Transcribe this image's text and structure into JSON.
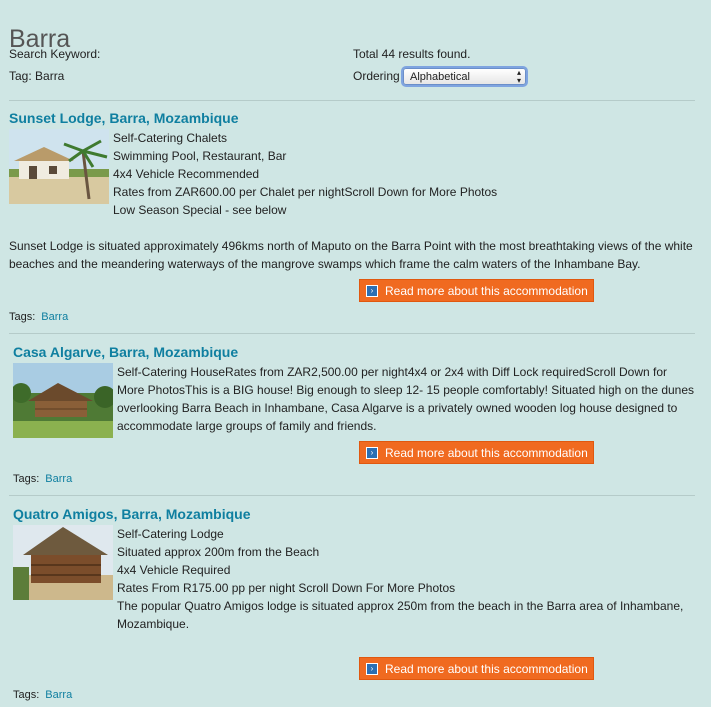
{
  "page": {
    "title": "Barra"
  },
  "search": {
    "keyword_label": "Search Keyword:",
    "tag_label": "Tag: Barra",
    "results_text": "Total 44 results found.",
    "ordering_label": "Ordering",
    "ordering_value": "Alphabetical"
  },
  "readmore_label": "Read more about this accommodation",
  "tags_label": "Tags:",
  "listings": [
    {
      "title": "Sunset Lodge, Barra, Mozambique",
      "details": [
        "Self-Catering Chalets",
        "Swimming Pool, Restaurant, Bar",
        "4x4 Vehicle Recommended",
        "Rates from ZAR600.00 per Chalet per nightScroll Down for More Photos",
        "Low Season Special - see below"
      ],
      "description": "Sunset Lodge is situated  approximately 496kms north of Maputo on the Barra Point with the most breathtaking views of the white beaches and the meandering waterways of the mangrove swamps which frame the calm waters of the Inhambane Bay.",
      "tag": "Barra"
    },
    {
      "title": "Casa Algarve, Barra, Mozambique",
      "description": "Self-Catering HouseRates from ZAR2,500.00 per night4x4 or 2x4 with Diff Lock requiredScroll Down for More PhotosThis is a BIG house! Big enough to sleep 12- 15 people comfortably! Situated high on the dunes overlooking Barra Beach in Inhambane, Casa Algarve is a privately owned wooden log house designed to accommodate large groups of family and friends.",
      "tag": "Barra"
    },
    {
      "title": "Quatro Amigos, Barra, Mozambique",
      "details": [
        "Self-Catering Lodge",
        "Situated approx 200m from the Beach",
        "4x4 Vehicle Required",
        "Rates From R175.00 pp per night Scroll Down For More Photos"
      ],
      "description": "The popular Quatro Amigos lodge is situated approx 250m from the beach in the Barra area of Inhambane, Mozambique.",
      "tag": "Barra"
    }
  ]
}
